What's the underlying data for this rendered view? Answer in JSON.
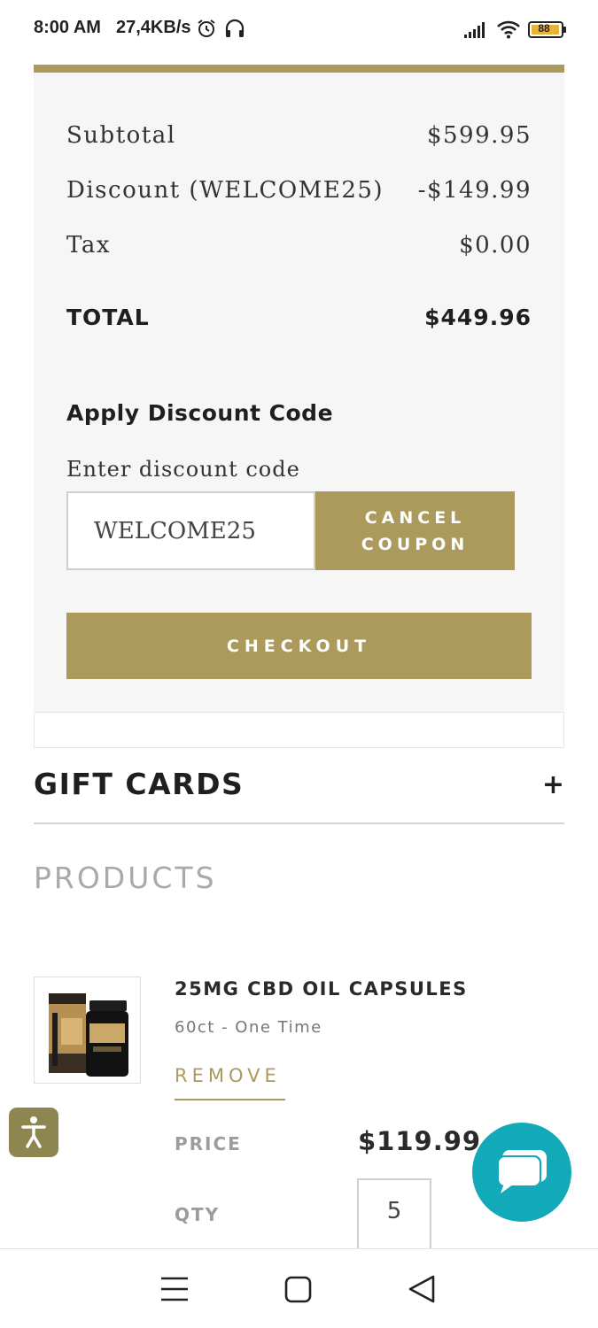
{
  "status_bar": {
    "time": "8:00 AM",
    "net_speed": "27,4KB/s",
    "battery_level": "88",
    "icons": [
      "alarm-icon",
      "headset-icon",
      "signal-icon",
      "wifi-icon",
      "battery-icon"
    ]
  },
  "colors": {
    "accent": "#ab9a5c",
    "panel_bg": "#f6f6f6",
    "chat": "#12a9b9",
    "accessibility": "#8e8651"
  },
  "summary": {
    "subtotal_label": "Subtotal",
    "subtotal_value": "$599.95",
    "discount_label": "Discount (WELCOME25)",
    "discount_value": "-$149.99",
    "tax_label": "Tax",
    "tax_value": "$0.00",
    "total_label": "TOTAL",
    "total_value": "$449.96"
  },
  "discount": {
    "heading": "Apply Discount Code",
    "input_label": "Enter discount code",
    "input_value": "WELCOME25",
    "cancel_line1": "CANCEL",
    "cancel_line2": "COUPON"
  },
  "checkout_label": "CHECKOUT",
  "gift_cards": {
    "title": "GIFT CARDS",
    "toggle": "+"
  },
  "products_heading": "PRODUCTS",
  "product": {
    "name": "25MG CBD OIL CAPSULES",
    "variant": "60ct - One Time",
    "remove_label": "REMOVE",
    "price_label": "PRICE",
    "price_value": "$119.99",
    "qty_label": "QTY",
    "qty_value": "5"
  },
  "nav": [
    "menu-icon",
    "home-icon",
    "back-icon"
  ]
}
